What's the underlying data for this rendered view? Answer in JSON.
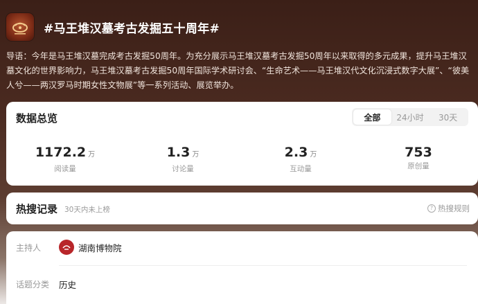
{
  "topic": {
    "title": "#马王堆汉墓考古发掘五十周年#",
    "intro": "导语：今年是马王堆汉墓完成考古发掘50周年。为充分展示马王堆汉墓考古发掘50周年以来取得的多元成果，提升马王堆汉墓文化的世界影响力，马王堆汉墓考古发掘50周年国际学术研讨会、“生命艺术——马王堆汉代文化沉浸式数字大展”、“彼美人兮——两汉罗马时期女性文物展”等一系列活动、展览举办。",
    "logo_icon": "museum-logo-icon"
  },
  "stats": {
    "heading": "数据总览",
    "tabs": [
      "全部",
      "24小时",
      "30天"
    ],
    "active_tab": "全部",
    "items": [
      {
        "value": "1172.2",
        "unit": "万",
        "label": "阅读量"
      },
      {
        "value": "1.3",
        "unit": "万",
        "label": "讨论量"
      },
      {
        "value": "2.3",
        "unit": "万",
        "label": "互动量"
      },
      {
        "value": "753",
        "unit": "",
        "label": "原创量"
      }
    ]
  },
  "hot": {
    "heading": "热搜记录",
    "sub": "30天内未上榜",
    "rules": "热搜规则",
    "rules_icon": "question-circle-icon"
  },
  "info": {
    "host_label": "主持人",
    "host_name": "湖南博物院",
    "host_avatar_color": "#b8262a",
    "category_label": "话题分类",
    "category_value": "历史"
  }
}
